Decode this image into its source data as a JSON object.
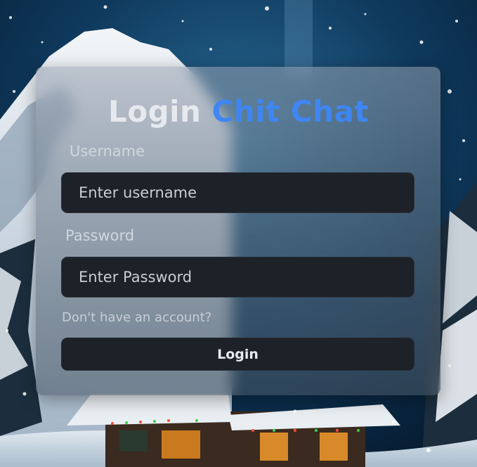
{
  "title": {
    "login": "Login",
    "brand": "Chit Chat"
  },
  "form": {
    "username_label": "Username",
    "username_placeholder": "Enter username",
    "password_label": "Password",
    "password_placeholder": "Enter Password",
    "signup_link": "Don't have an account?",
    "login_button": "Login"
  },
  "colors": {
    "accent": "#3f86f2",
    "field_bg": "#1d2128"
  },
  "background": {
    "image": "snowy-mountain-cabin-illustration"
  }
}
